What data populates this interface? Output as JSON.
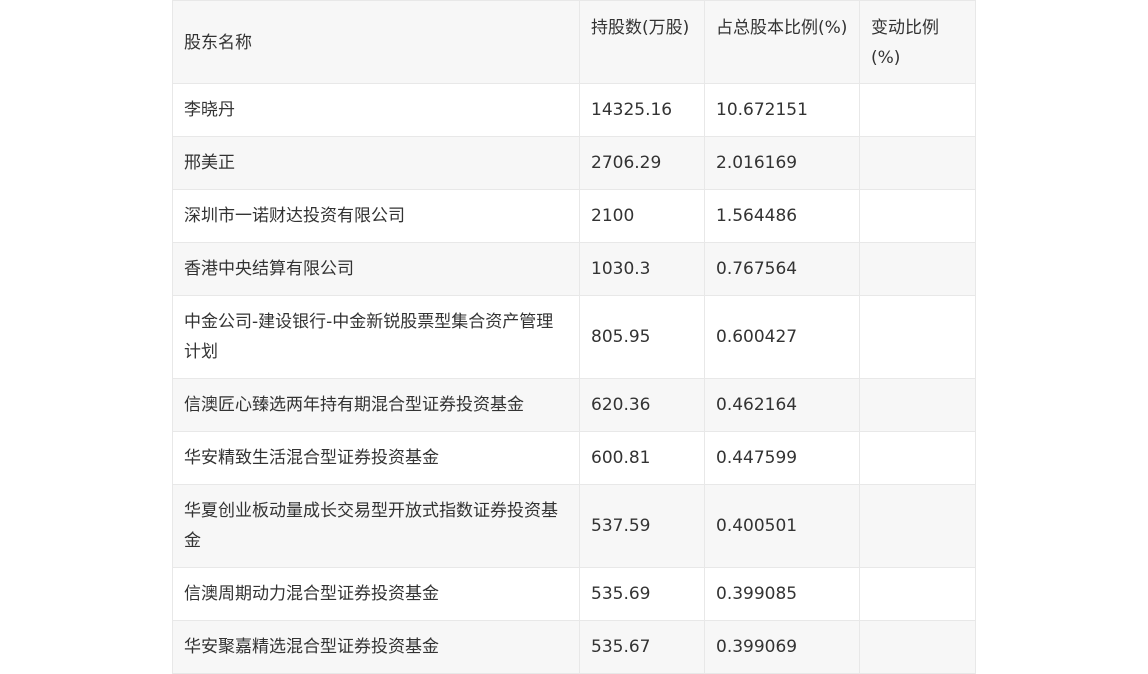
{
  "table": {
    "headers": [
      "股东名称",
      "持股数(万股)",
      "占总股本比例(%)",
      "变动比例(%)"
    ],
    "rows": [
      {
        "name": "李晓丹",
        "shares": "14325.16",
        "ratio": "10.672151",
        "change": ""
      },
      {
        "name": "邢美正",
        "shares": "2706.29",
        "ratio": "2.016169",
        "change": ""
      },
      {
        "name": "深圳市一诺财达投资有限公司",
        "shares": "2100",
        "ratio": "1.564486",
        "change": ""
      },
      {
        "name": "香港中央结算有限公司",
        "shares": "1030.3",
        "ratio": "0.767564",
        "change": ""
      },
      {
        "name": "中金公司-建设银行-中金新锐股票型集合资产管理计划",
        "shares": "805.95",
        "ratio": "0.600427",
        "change": ""
      },
      {
        "name": "信澳匠心臻选两年持有期混合型证券投资基金",
        "shares": "620.36",
        "ratio": "0.462164",
        "change": ""
      },
      {
        "name": "华安精致生活混合型证券投资基金",
        "shares": "600.81",
        "ratio": "0.447599",
        "change": ""
      },
      {
        "name": "华夏创业板动量成长交易型开放式指数证券投资基金",
        "shares": "537.59",
        "ratio": "0.400501",
        "change": ""
      },
      {
        "name": "信澳周期动力混合型证券投资基金",
        "shares": "535.69",
        "ratio": "0.399085",
        "change": ""
      },
      {
        "name": "华安聚嘉精选混合型证券投资基金",
        "shares": "535.67",
        "ratio": "0.399069",
        "change": ""
      }
    ]
  }
}
